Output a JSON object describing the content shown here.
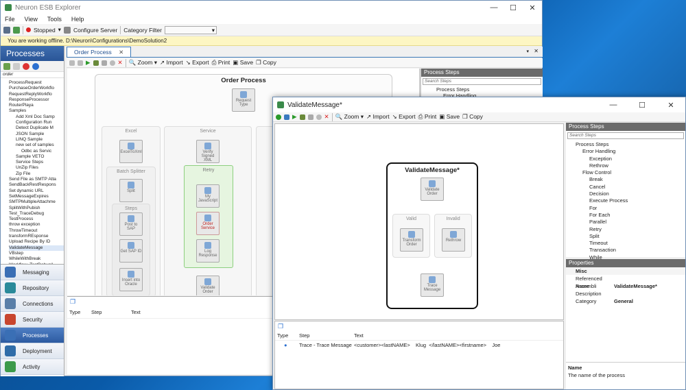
{
  "desktop": {
    "color": "#0a5aa8"
  },
  "main": {
    "title": "Neuron ESB Explorer",
    "menu": [
      "File",
      "View",
      "Tools",
      "Help"
    ],
    "toolbar": {
      "status": "Stopped",
      "configure": "Configure Server",
      "category_filter": "Category Filter",
      "category_value": ""
    },
    "banner": "You are working offline. D:\\Neuron\\Configurations\\DemoSolution2",
    "left": {
      "header": "Processes",
      "search": "order",
      "items": [
        "ProcessRequest",
        "PurchaseOrderWorkflo",
        "RequestReplyWorkflo",
        "ResponseProcessor",
        "RouterPlaya",
        "Samples",
        "Add Xml Doc Samp",
        "Configuration Run",
        "Detect Duplicate M",
        "JSON Sample",
        "LINQ Sample",
        "new set of samples",
        "Odbc as Servic",
        "Sample VETO",
        "Service Steps",
        "UnZip Files",
        "Zip File",
        "Send File as SMTP Atta",
        "SendBackRestRespons",
        "Set dynamic URL",
        "SetMessageExpires",
        "SMTPMultipleAttachme",
        "SplitWithPubish",
        "Test_TraceDebug",
        "TestProcess",
        "throw exception",
        "ThrowTimeout",
        "transformREsponse",
        "Upload Recipe By ID",
        "ValidateMessage",
        "VBstep",
        "WhileWithBreak",
        "Workflow_TestDebug1"
      ],
      "nav": [
        "Messaging",
        "Repository",
        "Connections",
        "Security",
        "Processes",
        "Deployment",
        "Activity"
      ]
    },
    "tab": "Order Process",
    "designer_toolbar": {
      "zoom": "Zoom",
      "import": "Import",
      "export": "Export",
      "print": "Print",
      "save": "Save",
      "copy": "Copy"
    },
    "canvas": {
      "title": "Order Process",
      "request": "Request Type",
      "excel": "Excel",
      "excel_node": "ExcelToXml",
      "batch": "Batch Splitter",
      "split": "Split",
      "steps": "Steps",
      "post": "Post to SAP",
      "get": "Get SAP ID",
      "insert": "Insert into Oracle",
      "service": "Service",
      "verify": "Verify Signed XML",
      "retry": "Retry",
      "myjs": "My JavaScript",
      "order_service": "Order Service",
      "log": "Log Response",
      "validate": "Validate Order"
    },
    "trace_cols": [
      "Type",
      "Step",
      "Text"
    ],
    "process_steps": {
      "header": "Process Steps",
      "search": "Search Steps",
      "items": [
        "Process Steps",
        "Error Handling"
      ]
    }
  },
  "dialog": {
    "title": "ValidateMessage*",
    "toolbar": {
      "zoom": "Zoom",
      "import": "Import",
      "export": "Export",
      "print": "Print",
      "save": "Save",
      "copy": "Copy"
    },
    "canvas": {
      "title": "ValidateMessage*",
      "validate": "Validate Order",
      "valid": "Valid",
      "invalid": "Invalid",
      "transform": "Transform Order",
      "rethrow": "Rethrow",
      "trace": "Trace Message"
    },
    "trace": {
      "cols": [
        "Type",
        "Step",
        "Text"
      ],
      "row": {
        "step": "Trace - Trace Message",
        "text": "<customer><lastNAME>    Klug  </lastNAME><firstname>    Joe"
      }
    },
    "steps": {
      "header": "Process Steps",
      "search": "Search Steps",
      "items": [
        "Process Steps",
        "Error Handling",
        "Exception",
        "Rethrow",
        "Flow Control",
        "Break",
        "Cancel",
        "Decision",
        "Execute Process",
        "For",
        "For Each",
        "Parallel",
        "Retry",
        "Split",
        "Timeout",
        "Transaction",
        "While"
      ]
    },
    "properties": {
      "header": "Properties",
      "category": "Misc",
      "rows": [
        {
          "name": "Referenced Assembli",
          "value": ""
        },
        {
          "name": "Name",
          "value": "ValidateMessage*"
        },
        {
          "name": "Description",
          "value": ""
        },
        {
          "name": "Category",
          "value": "General"
        }
      ],
      "help_title": "Name",
      "help_text": "The name of the process"
    }
  }
}
